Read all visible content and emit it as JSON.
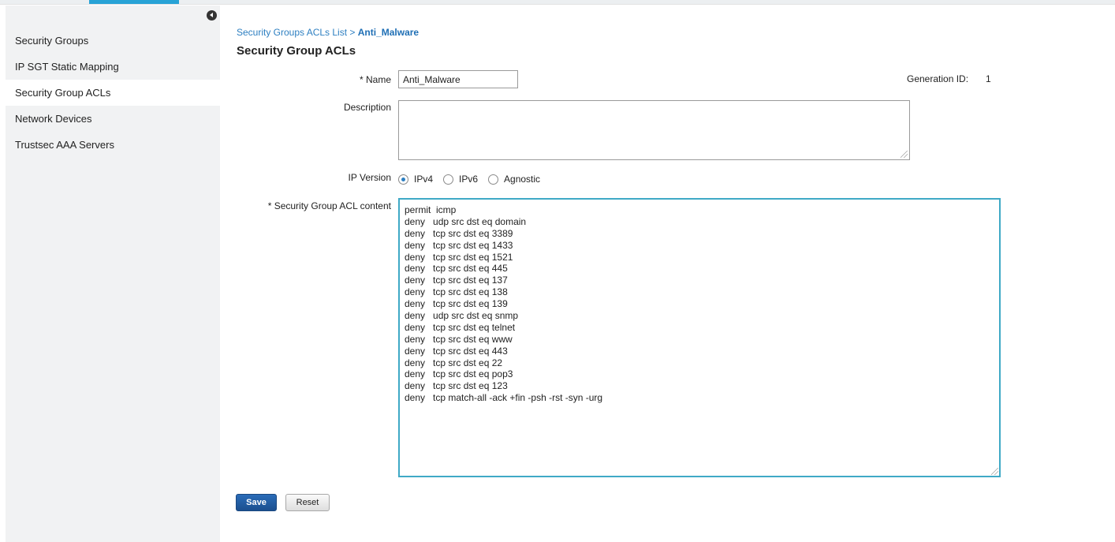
{
  "sidebar": {
    "items": [
      {
        "label": "Security Groups"
      },
      {
        "label": "IP SGT Static Mapping"
      },
      {
        "label": "Security Group ACLs"
      },
      {
        "label": "Network Devices"
      },
      {
        "label": "Trustsec AAA Servers"
      }
    ]
  },
  "breadcrumb": {
    "parent": "Security Groups ACLs List",
    "separator": " > ",
    "current": "Anti_Malware"
  },
  "page_title": "Security Group ACLs",
  "form": {
    "name_label": "* Name",
    "name_value": "Anti_Malware",
    "generation_label": "Generation ID:",
    "generation_value": "1",
    "description_label": "Description",
    "description_value": "",
    "ip_version_label": "IP Version",
    "ip_version_options": [
      "IPv4",
      "IPv6",
      "Agnostic"
    ],
    "ip_version_selected": "IPv4",
    "acl_content_label": "* Security Group ACL content",
    "acl_lines": [
      "permit  icmp",
      "deny   udp src dst eq domain",
      "deny   tcp src dst eq 3389",
      "deny   tcp src dst eq 1433",
      "deny   tcp src dst eq 1521",
      "deny   tcp src dst eq 445",
      "deny   tcp src dst eq 137",
      "deny   tcp src dst eq 138",
      "deny   tcp src dst eq 139",
      "deny   udp src dst eq snmp",
      "deny   tcp src dst eq telnet",
      "deny   tcp src dst eq www",
      "deny   tcp src dst eq 443",
      "deny   tcp src dst eq 22",
      "deny   tcp src dst eq pop3",
      "deny   tcp src dst eq 123",
      "deny   tcp match-all -ack +fin -psh -rst -syn -urg"
    ]
  },
  "buttons": {
    "save_label": "Save",
    "reset_label": "Reset"
  },
  "colors": {
    "accent": "#28a3d6",
    "link": "#2d7fc1",
    "primary_button": "#2a6cb8",
    "sidebar_bg": "#f1f2f3"
  }
}
